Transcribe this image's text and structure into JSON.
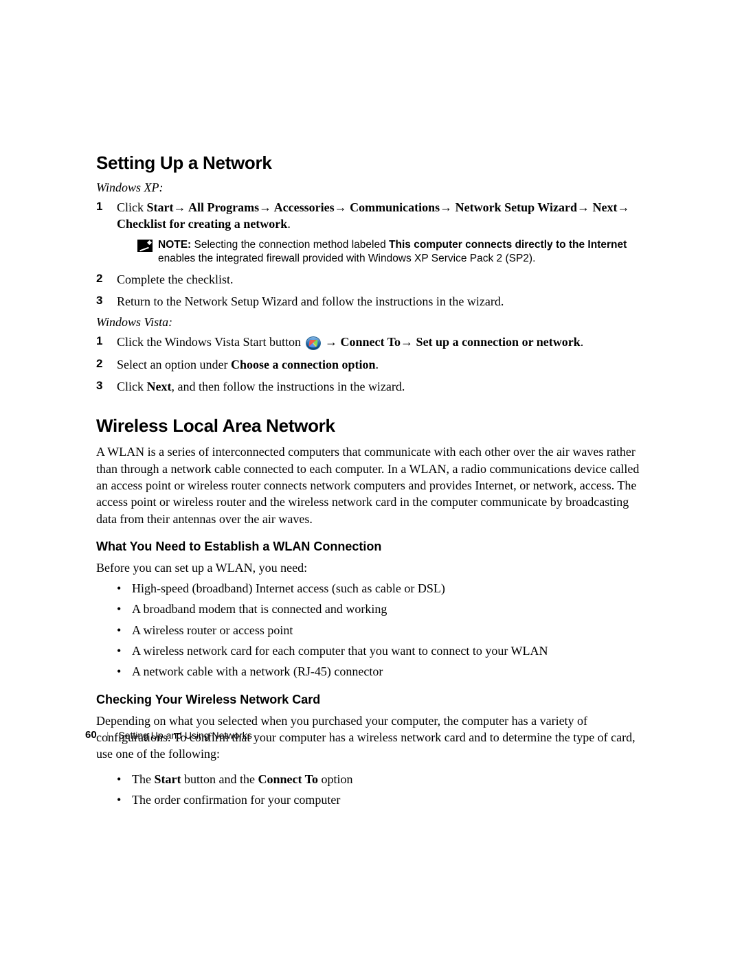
{
  "heading1": "Setting Up a Network",
  "xp": {
    "label": "Windows XP:",
    "step1_pre": "Click ",
    "step1_path": "Start→ All Programs→ Accessories→ Communications→ Network Setup Wizard→ Next→ Checklist for creating a network",
    "step1_post": ".",
    "note_label": "NOTE: ",
    "note_a": "Selecting the connection method labeled ",
    "note_bold": "This computer connects directly to the Internet",
    "note_b": " enables the integrated firewall provided with Windows XP Service Pack 2 (SP2).",
    "step2": "Complete the checklist.",
    "step3": "Return to the Network Setup Wizard and follow the instructions in the wizard."
  },
  "vista": {
    "label": "Windows Vista:",
    "step1_pre": "Click the Windows Vista Start button ",
    "step1_path": " → Connect To→ Set up a connection or network",
    "step1_post": ".",
    "step2_a": "Select an option under ",
    "step2_b": "Choose a connection option",
    "step2_c": ".",
    "step3_a": "Click ",
    "step3_b": "Next",
    "step3_c": ", and then follow the instructions in the wizard."
  },
  "heading2": "Wireless Local Area Network",
  "wlan_para": "A WLAN is a series of interconnected computers that communicate with each other over the air waves rather than through a network cable connected to each computer. In a WLAN, a radio communications device called an access point or wireless router connects network computers and provides Internet, or network, access. The access point or wireless router and the wireless network card in the computer communicate by broadcasting data from their antennas over the air waves.",
  "sub1": "What You Need to Establish a WLAN Connection",
  "sub1_intro": "Before you can set up a WLAN, you need:",
  "need": {
    "b1": "High-speed (broadband) Internet access (such as cable or DSL)",
    "b2": "A broadband modem that is connected and working",
    "b3": "A wireless router or access point",
    "b4": "A wireless network card for each computer that you want to connect to your WLAN",
    "b5": "A network cable with a network (RJ-45) connector"
  },
  "sub2": "Checking Your Wireless Network Card",
  "sub2_para": "Depending on what you selected when you purchased your computer, the computer has a variety of configurations. To confirm that your computer has a wireless network card and to determine the type of card, use one of the following:",
  "check": {
    "b1_a": "The ",
    "b1_b": "Start",
    "b1_c": " button and the ",
    "b1_d": "Connect To",
    "b1_e": " option",
    "b2": "The order confirmation for your computer"
  },
  "footer": {
    "page": "60",
    "section": "Setting Up and Using Networks"
  }
}
